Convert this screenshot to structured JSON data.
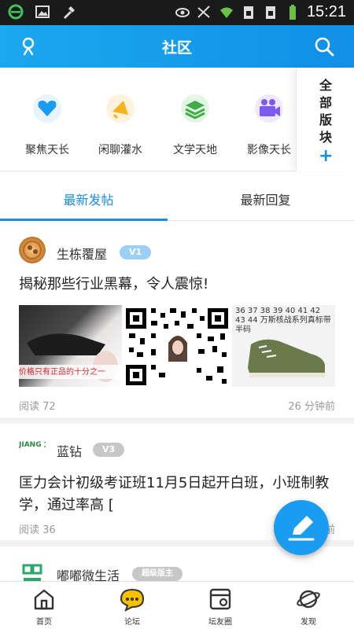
{
  "status_bar": {
    "time": "15:21",
    "icons": [
      "ie-icon",
      "image-icon",
      "tool-icon",
      "eye-icon",
      "mute-icon",
      "wifi-icon",
      "sim1-icon",
      "sim2-icon",
      "battery-icon"
    ]
  },
  "header": {
    "title": "社区"
  },
  "categories": [
    {
      "label": "聚焦天长",
      "icon": "heart-icon",
      "color": "#1a9cf0"
    },
    {
      "label": "闲聊灌水",
      "icon": "megaphone-icon",
      "color": "#f6b21b"
    },
    {
      "label": "文学天地",
      "icon": "layers-icon",
      "color": "#3fae49"
    },
    {
      "label": "影像天长",
      "icon": "video-icon",
      "color": "#7a5af0"
    }
  ],
  "all_boards": {
    "label": "全部版块",
    "chars": [
      "全",
      "部",
      "版",
      "块"
    ],
    "plus": "+"
  },
  "tabs": [
    {
      "label": "最新发帖",
      "active": true
    },
    {
      "label": "最新回复",
      "active": false
    }
  ],
  "posts": [
    {
      "user": "生栋覆屋",
      "level": "V1",
      "title": "揭秘那些行业黑幕，令人震惊!",
      "images": [
        {
          "caption": "价格只有正品的十分之一"
        },
        {
          "caption": ""
        },
        {
          "caption": "36 37 38 39 40 41 42 43 44 万斯核战系列真标带半码"
        }
      ],
      "reads": "阅读 72",
      "time": "26 分钟前"
    },
    {
      "user": "蓝钻",
      "level": "V3",
      "avatar_text": "JIANG 力会计",
      "title": "匡力会计初级考证班11月5日起开白班，小班制教学，通过率高 [",
      "reads": "阅读 36",
      "time": "前"
    },
    {
      "user": "嘟嘟微生活",
      "level": "超级版主"
    }
  ],
  "bottom_nav": [
    {
      "label": "首页",
      "icon": "home-icon"
    },
    {
      "label": "论坛",
      "icon": "chat-icon"
    },
    {
      "label": "坛友圈",
      "icon": "circle-icon"
    },
    {
      "label": "发现",
      "icon": "planet-icon"
    }
  ],
  "colors": {
    "accent": "#1a8ce6",
    "header": "#1aa8f0",
    "fab": "#1a9cf0"
  }
}
